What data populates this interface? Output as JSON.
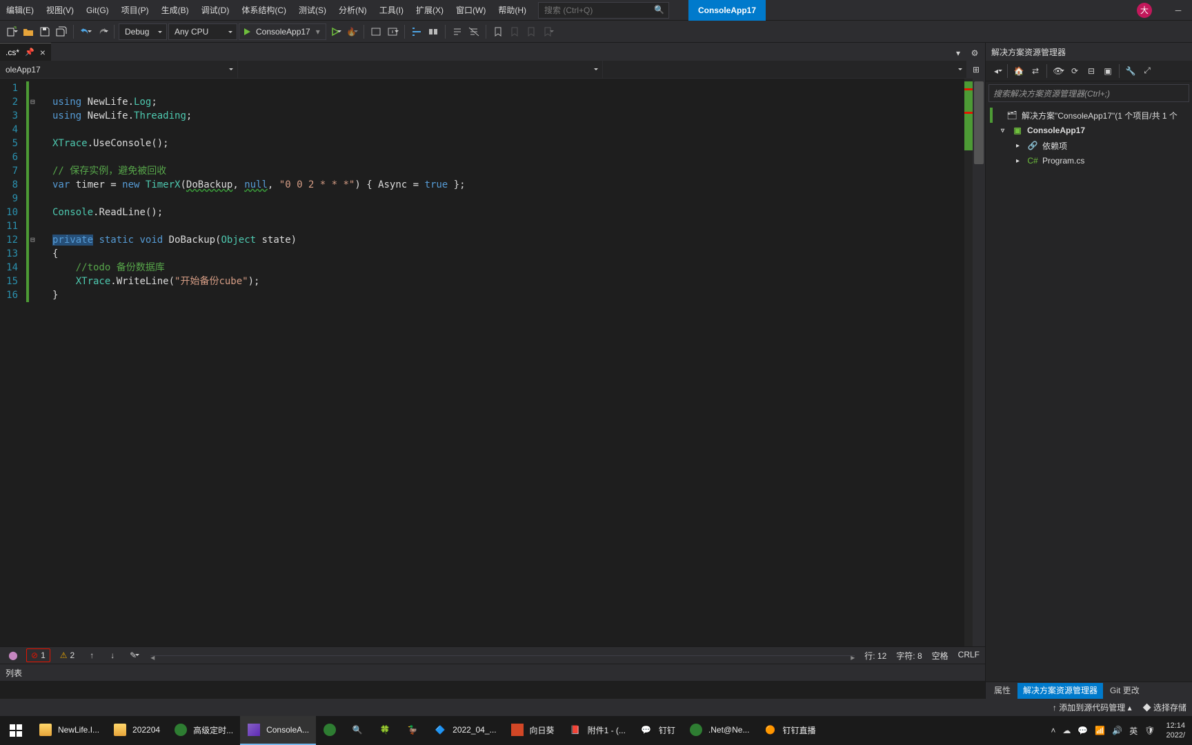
{
  "menu": {
    "items": [
      "编辑(E)",
      "视图(V)",
      "Git(G)",
      "项目(P)",
      "生成(B)",
      "调试(D)",
      "体系结构(C)",
      "测试(S)",
      "分析(N)",
      "工具(I)",
      "扩展(X)",
      "窗口(W)",
      "帮助(H)"
    ],
    "search_placeholder": "搜索 (Ctrl+Q)",
    "project_badge": "ConsoleApp17",
    "avatar_initial": "大"
  },
  "toolbar": {
    "config": "Debug",
    "platform": "Any CPU",
    "run_target": "ConsoleApp17"
  },
  "doc": {
    "tab_label": ".cs*",
    "nav1": "oleApp17"
  },
  "code": {
    "lines": [
      {
        "n": 1,
        "html": ""
      },
      {
        "n": 2,
        "html": "<span class='k-key'>using</span> NewLife.<span class='k-type'>Log</span>;"
      },
      {
        "n": 3,
        "html": "<span class='k-key'>using</span> NewLife.<span class='k-type'>Threading</span>;"
      },
      {
        "n": 4,
        "html": ""
      },
      {
        "n": 5,
        "html": "<span class='k-type'>XTrace</span>.UseConsole();"
      },
      {
        "n": 6,
        "html": ""
      },
      {
        "n": 7,
        "html": "<span class='k-cmt'>// 保存实例，避免被回收</span>"
      },
      {
        "n": 8,
        "html": "<span class='k-key'>var</span> timer = <span class='k-key'>new</span> <span class='k-type'>TimerX</span>(<span class='squig'>DoBackup</span>, <span class='squig k-key'>null</span>, <span class='k-str'>\"0 0 2 * * *\"</span>) { Async = <span class='k-key'>true</span> };"
      },
      {
        "n": 9,
        "html": ""
      },
      {
        "n": 10,
        "html": "<span class='k-type'>Console</span>.ReadLine();"
      },
      {
        "n": 11,
        "html": ""
      },
      {
        "n": 12,
        "html": "<span class='sel k-key'>private</span> <span class='k-key'>static</span> <span class='k-key'>void</span> DoBackup(<span class='k-type'>Object</span> state)"
      },
      {
        "n": 13,
        "html": "{"
      },
      {
        "n": 14,
        "html": "    <span class='k-cmt'>//todo 备份数据库</span>"
      },
      {
        "n": 15,
        "html": "    <span class='k-type'>XTrace</span>.WriteLine(<span class='k-str'>\"开始备份cube\"</span>);"
      },
      {
        "n": 16,
        "html": "}"
      }
    ]
  },
  "error_bar": {
    "error_count": "1",
    "warning_count": "2",
    "line_stat": "行: 12",
    "char_stat": "字符: 8",
    "indent": "空格",
    "eol": "CRLF"
  },
  "output": {
    "label": "列表"
  },
  "sln": {
    "title": "解决方案资源管理器",
    "search_placeholder": "搜索解决方案资源管理器(Ctrl+;)",
    "root": "解决方案\"ConsoleApp17\"(1 个项目/共 1 个",
    "proj": "ConsoleApp17",
    "dep": "依赖项",
    "file": "Program.cs",
    "tabs": [
      "属性",
      "解决方案资源管理器",
      "Git 更改"
    ]
  },
  "vs_status": {
    "add_src": "添加到源代码管理",
    "select_repo": "选择存储"
  },
  "taskbar": {
    "items": [
      {
        "label": "NewLife.I...",
        "cls": "orange-folder"
      },
      {
        "label": "202204",
        "cls": "orange-folder"
      },
      {
        "label": "高级定时...",
        "cls": "green-dot",
        "bg": "#222"
      },
      {
        "label": "ConsoleA...",
        "cls": "blue-vs",
        "active": true
      },
      {
        "label": "",
        "cls": "green-dot",
        "icon_only": true
      },
      {
        "label": "",
        "cls": "",
        "icon_only": true,
        "emoji": "🔍"
      },
      {
        "label": "",
        "cls": "",
        "icon_only": true,
        "emoji": "🍀"
      },
      {
        "label": "",
        "cls": "",
        "icon_only": true,
        "emoji": "🦆"
      },
      {
        "label": "2022_04_...",
        "cls": "",
        "emoji": "🔷"
      },
      {
        "label": "向日葵",
        "cls": "red-sq"
      },
      {
        "label": "附件1 - (...",
        "cls": "",
        "emoji": "📕"
      },
      {
        "label": "钉钉",
        "cls": "",
        "emoji": "💬"
      },
      {
        "label": ".Net@Ne...",
        "cls": "green-dot"
      },
      {
        "label": "钉钉直播",
        "cls": "",
        "emoji": "🟠"
      }
    ],
    "clock_time": "12:14",
    "clock_date": "2022/"
  }
}
